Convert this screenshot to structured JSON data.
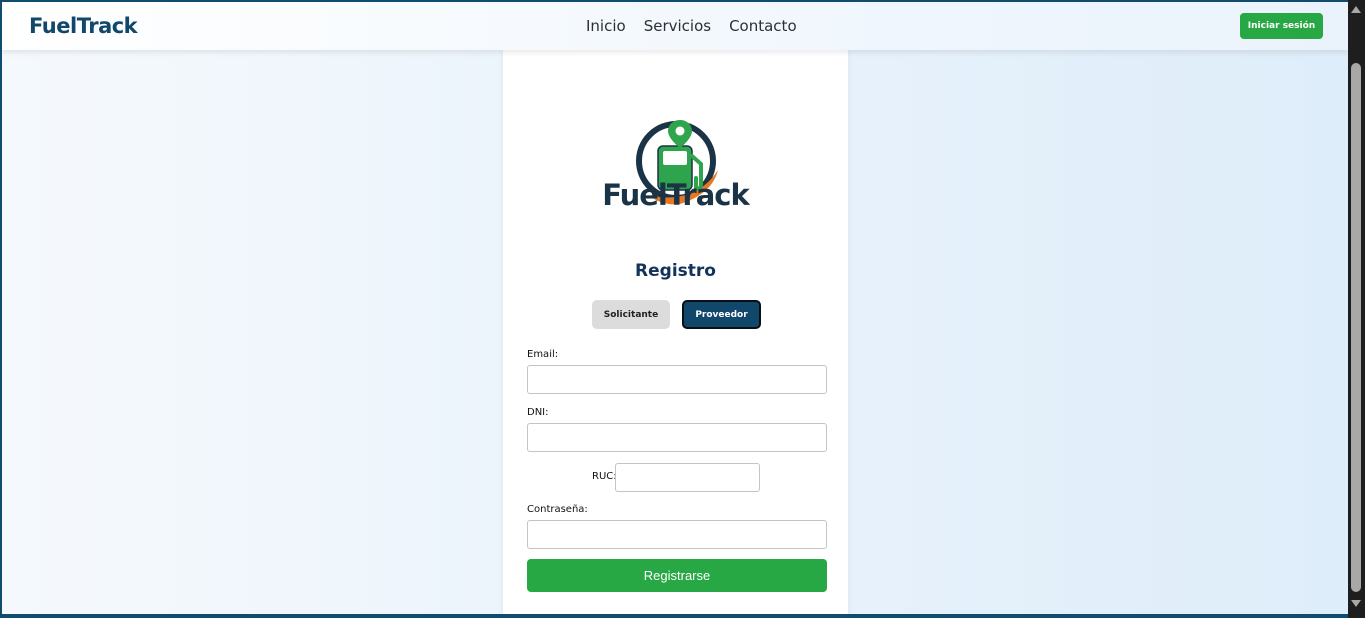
{
  "navbar": {
    "brand": "FuelTrack",
    "links": [
      "Inicio",
      "Servicios",
      "Contacto"
    ],
    "login_label": "Iniciar sesión"
  },
  "card": {
    "logo_text": "FuelTrack",
    "title": "Registro",
    "toggles": {
      "solicitante": "Solicitante",
      "proveedor": "Proveedor",
      "selected": "Proveedor"
    },
    "fields": {
      "email_label": "Email:",
      "email_value": "",
      "dni_label": "DNI:",
      "dni_value": "",
      "ruc_label": "RUC:",
      "ruc_value": "",
      "password_label": "Contraseña:",
      "password_value": ""
    },
    "submit_label": "Registrarse"
  },
  "colors": {
    "brand": "#11476a",
    "accent_green": "#28a745",
    "logo_orange": "#e87722",
    "logo_dark": "#1b3346"
  },
  "icons": {
    "logo": "fuel-pump-location-icon"
  }
}
